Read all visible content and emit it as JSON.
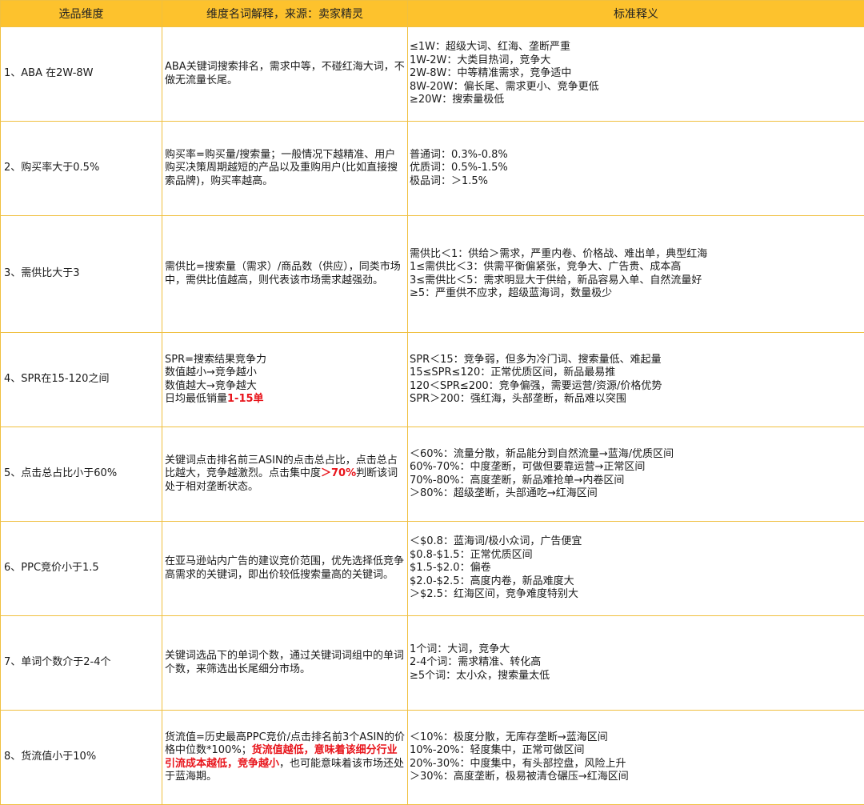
{
  "headers": [
    "选品维度",
    "维度名词解释，来源：卖家精灵",
    "标准释义"
  ],
  "rows": [
    {
      "dimension": "1、ABA 在2W-8W",
      "definition": [
        {
          "t": "ABA关键词搜索排名，需求中等，不碰红海大词，不做无流量长尾。",
          "red": false
        }
      ],
      "standard": [
        "≤1W：超级大词、红海、垄断严重",
        "1W-2W：大类目热词，竞争大",
        "2W-8W：中等精准需求，竞争适中",
        "8W-20W：偏长尾、需求更小、竞争更低",
        "≥20W：搜索量极低"
      ]
    },
    {
      "dimension": "2、购买率大于0.5%",
      "definition": [
        {
          "t": "购买率=购买量/搜索量；一般情况下越精准、用户购买决策周期越短的产品以及重购用户(比如直接搜索品牌)，购买率越高。",
          "red": false
        }
      ],
      "standard": [
        "普通词：0.3%-0.8%",
        "优质词：0.5%-1.5%",
        "极品词：＞1.5%"
      ]
    },
    {
      "dimension": "3、需供比大于3",
      "definition": [
        {
          "t": "需供比=搜索量（需求）/商品数（供应），同类市场中，需供比值越高，则代表该市场需求越强劲。",
          "red": false
        }
      ],
      "standard": [
        "需供比＜1：供给＞需求，严重内卷、价格战、难出单，典型红海",
        "1≤需供比＜3：供需平衡偏紧张，竞争大、广告贵、成本高",
        "3≤需供比＜5：需求明显大于供给，新品容易入单、自然流量好",
        "≥5：严重供不应求，超级蓝海词，数量极少"
      ]
    },
    {
      "dimension": "4、SPR在15-120之间",
      "definition": [
        {
          "t": "SPR=搜索结果竞争力",
          "red": false,
          "br": true
        },
        {
          "t": "数值越小→竞争越小",
          "red": false,
          "br": true
        },
        {
          "t": "数值越大→竞争越大",
          "red": false,
          "br": true
        },
        {
          "t": "日均最低销量",
          "red": false
        },
        {
          "t": "1-15单",
          "red": true
        }
      ],
      "standard": [
        "SPR＜15：竞争弱，但多为冷门词、搜索量低、难起量",
        "15≤SPR≤120：正常优质区间，新品最易推",
        "120＜SPR≤200：竞争偏强，需要运营/资源/价格优势",
        "SPR＞200：强红海，头部垄断，新品难以突围"
      ]
    },
    {
      "dimension": "5、点击总占比小于60%",
      "definition": [
        {
          "t": "关键词点击排名前三ASIN的点击总占比，点击总占比越大，竞争越激烈。点击集中度",
          "red": false
        },
        {
          "t": "＞70%",
          "red": true
        },
        {
          "t": "判断该词处于相对垄断状态。",
          "red": false
        }
      ],
      "standard": [
        "＜60%：流量分散，新品能分到自然流量→蓝海/优质区间",
        "60%-70%：中度垄断，可做但要靠运营→正常区间",
        "70%-80%：高度垄断，新品难抢单→内卷区间",
        "＞80%：超级垄断，头部通吃→红海区间"
      ]
    },
    {
      "dimension": "6、PPC竞价小于1.5",
      "definition": [
        {
          "t": "在亚马逊站内广告的建议竞价范围，优先选择低竞争高需求的关键词，即出价较低搜索量高的关键词。",
          "red": false
        }
      ],
      "standard": [
        "＜$0.8：蓝海词/极小众词，广告便宜",
        "$0.8-$1.5：正常优质区间",
        "$1.5-$2.0：偏卷",
        "$2.0-$2.5：高度内卷，新品难度大",
        "＞$2.5：红海区间，竞争难度特别大"
      ]
    },
    {
      "dimension": "7、单词个数介于2-4个",
      "definition": [
        {
          "t": "关键词选品下的单词个数，通过关键词词组中的单词个数，来筛选出长尾细分市场。",
          "red": false
        }
      ],
      "standard": [
        "1个词：大词，竞争大",
        "2-4个词：需求精准、转化高",
        "≥5个词：太小众，搜索量太低"
      ]
    },
    {
      "dimension": "8、货流值小于10%",
      "definition": [
        {
          "t": "货流值=历史最高PPC竞价/点击排名前3个ASIN的价格中位数*100%；",
          "red": false
        },
        {
          "t": "货流值越低，意味着该细分行业引流成本越低，竞争越小",
          "red": true
        },
        {
          "t": "，也可能意味着该市场还处于蓝海期。",
          "red": false
        }
      ],
      "standard": [
        "＜10%：极度分散，无库存垄断→蓝海区间",
        "10%-20%：轻度集中，正常可做区间",
        "20%-30%：中度集中，有头部控盘，风险上升",
        "＞30%：高度垄断，极易被清仓碾压→红海区间"
      ]
    }
  ]
}
